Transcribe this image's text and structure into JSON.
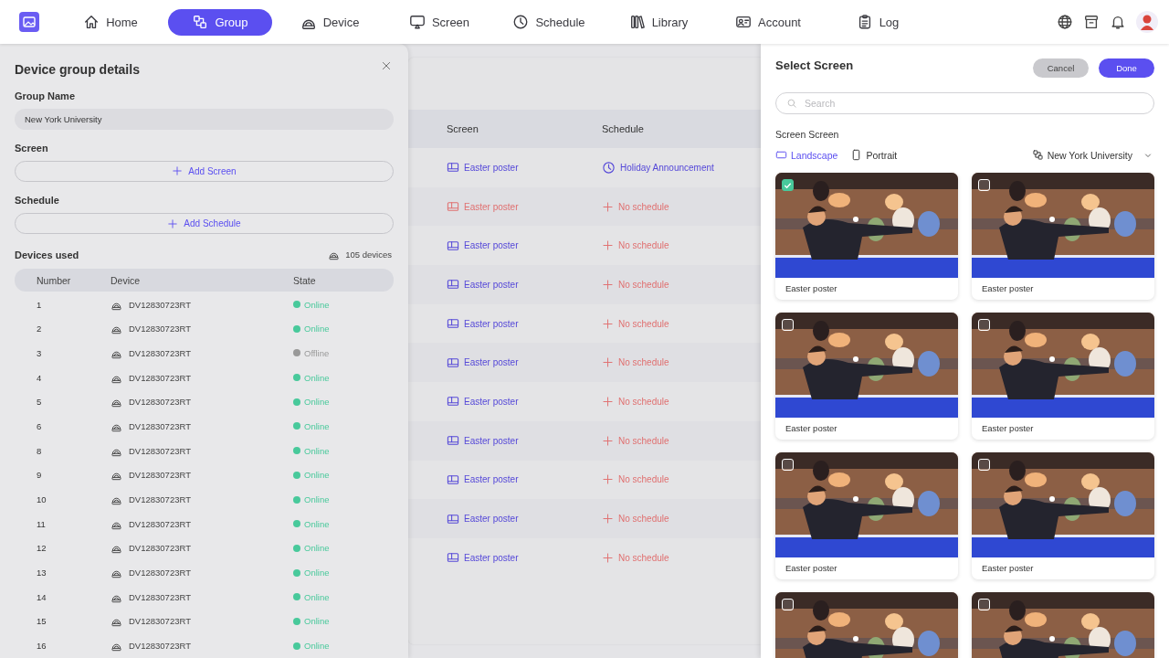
{
  "nav": {
    "items": [
      {
        "label": "Home",
        "selected": false
      },
      {
        "label": "Group",
        "selected": true
      },
      {
        "label": "Device",
        "selected": false
      },
      {
        "label": "Screen",
        "selected": false
      },
      {
        "label": "Schedule",
        "selected": false
      },
      {
        "label": "Library",
        "selected": false
      },
      {
        "label": "Account",
        "selected": false
      },
      {
        "label": "Log",
        "selected": false
      }
    ]
  },
  "group_details": {
    "title": "Device group details",
    "group_name_label": "Group Name",
    "group_name_value": "New York University",
    "screen_label": "Screen",
    "add_screen": "Add Screen",
    "schedule_label": "Schedule",
    "add_schedule": "Add Schedule",
    "devices_label": "Devices used",
    "device_count": "105 devices",
    "columns": [
      "Number",
      "Device",
      "State"
    ],
    "rows": [
      {
        "number": "1",
        "device": "DV12830723RT",
        "state": "Online",
        "online": true
      },
      {
        "number": "2",
        "device": "DV12830723RT",
        "state": "Online",
        "online": true
      },
      {
        "number": "3",
        "device": "DV12830723RT",
        "state": "Offline",
        "online": false
      },
      {
        "number": "4",
        "device": "DV12830723RT",
        "state": "Online",
        "online": true
      },
      {
        "number": "5",
        "device": "DV12830723RT",
        "state": "Online",
        "online": true
      },
      {
        "number": "6",
        "device": "DV12830723RT",
        "state": "Online",
        "online": true
      },
      {
        "number": "8",
        "device": "DV12830723RT",
        "state": "Online",
        "online": true
      },
      {
        "number": "9",
        "device": "DV12830723RT",
        "state": "Online",
        "online": true
      },
      {
        "number": "10",
        "device": "DV12830723RT",
        "state": "Online",
        "online": true
      },
      {
        "number": "11",
        "device": "DV12830723RT",
        "state": "Online",
        "online": true
      },
      {
        "number": "12",
        "device": "DV12830723RT",
        "state": "Online",
        "online": true
      },
      {
        "number": "13",
        "device": "DV12830723RT",
        "state": "Online",
        "online": true
      },
      {
        "number": "14",
        "device": "DV12830723RT",
        "state": "Online",
        "online": true
      },
      {
        "number": "15",
        "device": "DV12830723RT",
        "state": "Online",
        "online": true
      },
      {
        "number": "16",
        "device": "DV12830723RT",
        "state": "Online",
        "online": true
      }
    ]
  },
  "background_table": {
    "columns": [
      "Screen",
      "Schedule"
    ],
    "rows": [
      {
        "screen": "Easter poster",
        "warning": false,
        "schedule": "Holiday Announcement",
        "scheduled": true
      },
      {
        "screen": "Easter poster",
        "warning": true,
        "schedule": "No schedule",
        "scheduled": false
      },
      {
        "screen": "Easter poster",
        "warning": false,
        "schedule": "No schedule",
        "scheduled": false
      },
      {
        "screen": "Easter poster",
        "warning": false,
        "schedule": "No schedule",
        "scheduled": false
      },
      {
        "screen": "Easter poster",
        "warning": false,
        "schedule": "No schedule",
        "scheduled": false
      },
      {
        "screen": "Easter poster",
        "warning": false,
        "schedule": "No schedule",
        "scheduled": false
      },
      {
        "screen": "Easter poster",
        "warning": false,
        "schedule": "No schedule",
        "scheduled": false
      },
      {
        "screen": "Easter poster",
        "warning": false,
        "schedule": "No schedule",
        "scheduled": false
      },
      {
        "screen": "Easter poster",
        "warning": false,
        "schedule": "No schedule",
        "scheduled": false
      },
      {
        "screen": "Easter poster",
        "warning": false,
        "schedule": "No schedule",
        "scheduled": false
      },
      {
        "screen": "Easter poster",
        "warning": false,
        "schedule": "No schedule",
        "scheduled": false
      }
    ]
  },
  "select_screen": {
    "title": "Select Screen",
    "cancel": "Cancel",
    "done": "Done",
    "search": {
      "placeholder": "Search"
    },
    "section_label": "Screen Screen",
    "orientation_tabs": [
      {
        "label": "Landscape",
        "selected": true
      },
      {
        "label": "Portrait",
        "selected": false
      }
    ],
    "group_filter": "New York University",
    "cards": [
      {
        "label": "Easter poster",
        "checked": true
      },
      {
        "label": "Easter poster",
        "checked": false
      },
      {
        "label": "Easter poster",
        "checked": false
      },
      {
        "label": "Easter poster",
        "checked": false
      },
      {
        "label": "Easter poster",
        "checked": false
      },
      {
        "label": "Easter poster",
        "checked": false
      },
      {
        "checked": false
      },
      {
        "checked": false
      }
    ]
  }
}
